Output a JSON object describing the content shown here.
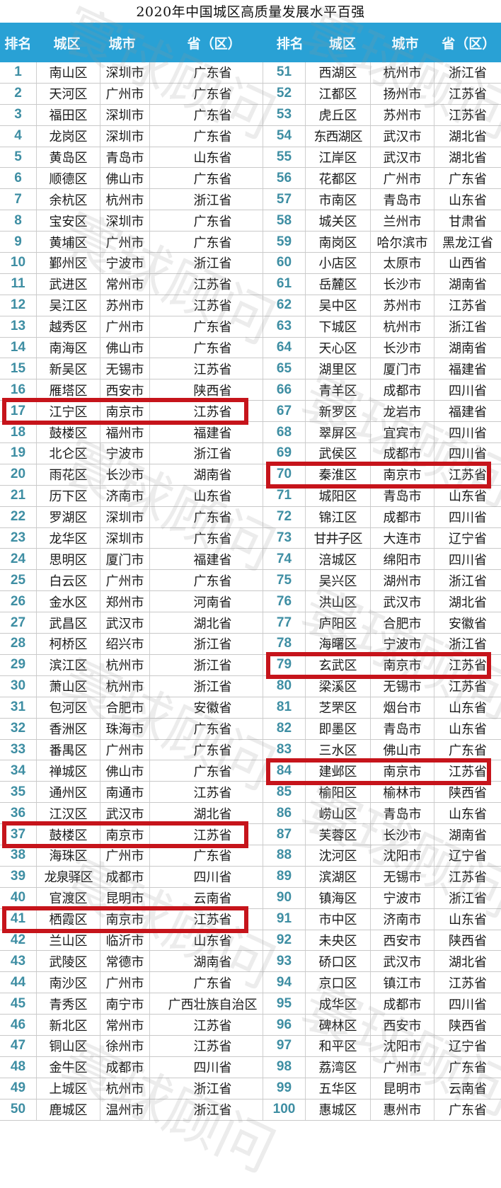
{
  "title": "2020年中国城区高质量发展水平百强",
  "headers": [
    "排名",
    "城区",
    "城市",
    "省（区）",
    "排名",
    "城区",
    "城市",
    "省（区）"
  ],
  "watermark": "寰球顾问",
  "highlight_color": "#c6141b",
  "header_color": "#29a1d5",
  "highlighted_ranks": [
    17,
    37,
    41,
    70,
    79,
    84
  ],
  "rows": [
    {
      "rank": "1",
      "district": "南山区",
      "city": "深圳市",
      "province": "广东省"
    },
    {
      "rank": "2",
      "district": "天河区",
      "city": "广州市",
      "province": "广东省"
    },
    {
      "rank": "3",
      "district": "福田区",
      "city": "深圳市",
      "province": "广东省"
    },
    {
      "rank": "4",
      "district": "龙岗区",
      "city": "深圳市",
      "province": "广东省"
    },
    {
      "rank": "5",
      "district": "黄岛区",
      "city": "青岛市",
      "province": "山东省"
    },
    {
      "rank": "6",
      "district": "顺德区",
      "city": "佛山市",
      "province": "广东省"
    },
    {
      "rank": "7",
      "district": "余杭区",
      "city": "杭州市",
      "province": "浙江省"
    },
    {
      "rank": "8",
      "district": "宝安区",
      "city": "深圳市",
      "province": "广东省"
    },
    {
      "rank": "9",
      "district": "黄埔区",
      "city": "广州市",
      "province": "广东省"
    },
    {
      "rank": "10",
      "district": "鄞州区",
      "city": "宁波市",
      "province": "浙江省"
    },
    {
      "rank": "11",
      "district": "武进区",
      "city": "常州市",
      "province": "江苏省"
    },
    {
      "rank": "12",
      "district": "吴江区",
      "city": "苏州市",
      "province": "江苏省"
    },
    {
      "rank": "13",
      "district": "越秀区",
      "city": "广州市",
      "province": "广东省"
    },
    {
      "rank": "14",
      "district": "南海区",
      "city": "佛山市",
      "province": "广东省"
    },
    {
      "rank": "15",
      "district": "新吴区",
      "city": "无锡市",
      "province": "江苏省"
    },
    {
      "rank": "16",
      "district": "雁塔区",
      "city": "西安市",
      "province": "陕西省"
    },
    {
      "rank": "17",
      "district": "江宁区",
      "city": "南京市",
      "province": "江苏省"
    },
    {
      "rank": "18",
      "district": "鼓楼区",
      "city": "福州市",
      "province": "福建省"
    },
    {
      "rank": "19",
      "district": "北仑区",
      "city": "宁波市",
      "province": "浙江省"
    },
    {
      "rank": "20",
      "district": "雨花区",
      "city": "长沙市",
      "province": "湖南省"
    },
    {
      "rank": "21",
      "district": "历下区",
      "city": "济南市",
      "province": "山东省"
    },
    {
      "rank": "22",
      "district": "罗湖区",
      "city": "深圳市",
      "province": "广东省"
    },
    {
      "rank": "23",
      "district": "龙华区",
      "city": "深圳市",
      "province": "广东省"
    },
    {
      "rank": "24",
      "district": "思明区",
      "city": "厦门市",
      "province": "福建省"
    },
    {
      "rank": "25",
      "district": "白云区",
      "city": "广州市",
      "province": "广东省"
    },
    {
      "rank": "26",
      "district": "金水区",
      "city": "郑州市",
      "province": "河南省"
    },
    {
      "rank": "27",
      "district": "武昌区",
      "city": "武汉市",
      "province": "湖北省"
    },
    {
      "rank": "28",
      "district": "柯桥区",
      "city": "绍兴市",
      "province": "浙江省"
    },
    {
      "rank": "29",
      "district": "滨江区",
      "city": "杭州市",
      "province": "浙江省"
    },
    {
      "rank": "30",
      "district": "萧山区",
      "city": "杭州市",
      "province": "浙江省"
    },
    {
      "rank": "31",
      "district": "包河区",
      "city": "合肥市",
      "province": "安徽省"
    },
    {
      "rank": "32",
      "district": "香洲区",
      "city": "珠海市",
      "province": "广东省"
    },
    {
      "rank": "33",
      "district": "番禺区",
      "city": "广州市",
      "province": "广东省"
    },
    {
      "rank": "34",
      "district": "禅城区",
      "city": "佛山市",
      "province": "广东省"
    },
    {
      "rank": "35",
      "district": "通州区",
      "city": "南通市",
      "province": "江苏省"
    },
    {
      "rank": "36",
      "district": "江汉区",
      "city": "武汉市",
      "province": "湖北省"
    },
    {
      "rank": "37",
      "district": "鼓楼区",
      "city": "南京市",
      "province": "江苏省"
    },
    {
      "rank": "38",
      "district": "海珠区",
      "city": "广州市",
      "province": "广东省"
    },
    {
      "rank": "39",
      "district": "龙泉驿区",
      "city": "成都市",
      "province": "四川省"
    },
    {
      "rank": "40",
      "district": "官渡区",
      "city": "昆明市",
      "province": "云南省"
    },
    {
      "rank": "41",
      "district": "栖霞区",
      "city": "南京市",
      "province": "江苏省"
    },
    {
      "rank": "42",
      "district": "兰山区",
      "city": "临沂市",
      "province": "山东省"
    },
    {
      "rank": "43",
      "district": "武陵区",
      "city": "常德市",
      "province": "湖南省"
    },
    {
      "rank": "44",
      "district": "南沙区",
      "city": "广州市",
      "province": "广东省"
    },
    {
      "rank": "45",
      "district": "青秀区",
      "city": "南宁市",
      "province": "广西壮族自治区"
    },
    {
      "rank": "46",
      "district": "新北区",
      "city": "常州市",
      "province": "江苏省"
    },
    {
      "rank": "47",
      "district": "铜山区",
      "city": "徐州市",
      "province": "江苏省"
    },
    {
      "rank": "48",
      "district": "金牛区",
      "city": "成都市",
      "province": "四川省"
    },
    {
      "rank": "49",
      "district": "上城区",
      "city": "杭州市",
      "province": "浙江省"
    },
    {
      "rank": "50",
      "district": "鹿城区",
      "city": "温州市",
      "province": "浙江省"
    },
    {
      "rank": "51",
      "district": "西湖区",
      "city": "杭州市",
      "province": "浙江省"
    },
    {
      "rank": "52",
      "district": "江都区",
      "city": "扬州市",
      "province": "江苏省"
    },
    {
      "rank": "53",
      "district": "虎丘区",
      "city": "苏州市",
      "province": "江苏省"
    },
    {
      "rank": "54",
      "district": "东西湖区",
      "city": "武汉市",
      "province": "湖北省"
    },
    {
      "rank": "55",
      "district": "江岸区",
      "city": "武汉市",
      "province": "湖北省"
    },
    {
      "rank": "56",
      "district": "花都区",
      "city": "广州市",
      "province": "广东省"
    },
    {
      "rank": "57",
      "district": "市南区",
      "city": "青岛市",
      "province": "山东省"
    },
    {
      "rank": "58",
      "district": "城关区",
      "city": "兰州市",
      "province": "甘肃省"
    },
    {
      "rank": "59",
      "district": "南岗区",
      "city": "哈尔滨市",
      "province": "黑龙江省"
    },
    {
      "rank": "60",
      "district": "小店区",
      "city": "太原市",
      "province": "山西省"
    },
    {
      "rank": "61",
      "district": "岳麓区",
      "city": "长沙市",
      "province": "湖南省"
    },
    {
      "rank": "62",
      "district": "吴中区",
      "city": "苏州市",
      "province": "江苏省"
    },
    {
      "rank": "63",
      "district": "下城区",
      "city": "杭州市",
      "province": "浙江省"
    },
    {
      "rank": "64",
      "district": "天心区",
      "city": "长沙市",
      "province": "湖南省"
    },
    {
      "rank": "65",
      "district": "湖里区",
      "city": "厦门市",
      "province": "福建省"
    },
    {
      "rank": "66",
      "district": "青羊区",
      "city": "成都市",
      "province": "四川省"
    },
    {
      "rank": "67",
      "district": "新罗区",
      "city": "龙岩市",
      "province": "福建省"
    },
    {
      "rank": "68",
      "district": "翠屏区",
      "city": "宜宾市",
      "province": "四川省"
    },
    {
      "rank": "69",
      "district": "武侯区",
      "city": "成都市",
      "province": "四川省"
    },
    {
      "rank": "70",
      "district": "秦淮区",
      "city": "南京市",
      "province": "江苏省"
    },
    {
      "rank": "71",
      "district": "城阳区",
      "city": "青岛市",
      "province": "山东省"
    },
    {
      "rank": "72",
      "district": "锦江区",
      "city": "成都市",
      "province": "四川省"
    },
    {
      "rank": "73",
      "district": "甘井子区",
      "city": "大连市",
      "province": "辽宁省"
    },
    {
      "rank": "74",
      "district": "涪城区",
      "city": "绵阳市",
      "province": "四川省"
    },
    {
      "rank": "75",
      "district": "吴兴区",
      "city": "湖州市",
      "province": "浙江省"
    },
    {
      "rank": "76",
      "district": "洪山区",
      "city": "武汉市",
      "province": "湖北省"
    },
    {
      "rank": "77",
      "district": "庐阳区",
      "city": "合肥市",
      "province": "安徽省"
    },
    {
      "rank": "78",
      "district": "海曙区",
      "city": "宁波市",
      "province": "浙江省"
    },
    {
      "rank": "79",
      "district": "玄武区",
      "city": "南京市",
      "province": "江苏省"
    },
    {
      "rank": "80",
      "district": "梁溪区",
      "city": "无锡市",
      "province": "江苏省"
    },
    {
      "rank": "81",
      "district": "芝罘区",
      "city": "烟台市",
      "province": "山东省"
    },
    {
      "rank": "82",
      "district": "即墨区",
      "city": "青岛市",
      "province": "山东省"
    },
    {
      "rank": "83",
      "district": "三水区",
      "city": "佛山市",
      "province": "广东省"
    },
    {
      "rank": "84",
      "district": "建邺区",
      "city": "南京市",
      "province": "江苏省"
    },
    {
      "rank": "85",
      "district": "榆阳区",
      "city": "榆林市",
      "province": "陕西省"
    },
    {
      "rank": "86",
      "district": "崂山区",
      "city": "青岛市",
      "province": "山东省"
    },
    {
      "rank": "87",
      "district": "芙蓉区",
      "city": "长沙市",
      "province": "湖南省"
    },
    {
      "rank": "88",
      "district": "沈河区",
      "city": "沈阳市",
      "province": "辽宁省"
    },
    {
      "rank": "89",
      "district": "滨湖区",
      "city": "无锡市",
      "province": "江苏省"
    },
    {
      "rank": "90",
      "district": "镇海区",
      "city": "宁波市",
      "province": "浙江省"
    },
    {
      "rank": "91",
      "district": "市中区",
      "city": "济南市",
      "province": "山东省"
    },
    {
      "rank": "92",
      "district": "未央区",
      "city": "西安市",
      "province": "陕西省"
    },
    {
      "rank": "93",
      "district": "硚口区",
      "city": "武汉市",
      "province": "湖北省"
    },
    {
      "rank": "94",
      "district": "京口区",
      "city": "镇江市",
      "province": "江苏省"
    },
    {
      "rank": "95",
      "district": "成华区",
      "city": "成都市",
      "province": "四川省"
    },
    {
      "rank": "96",
      "district": "碑林区",
      "city": "西安市",
      "province": "陕西省"
    },
    {
      "rank": "97",
      "district": "和平区",
      "city": "沈阳市",
      "province": "辽宁省"
    },
    {
      "rank": "98",
      "district": "荔湾区",
      "city": "广州市",
      "province": "广东省"
    },
    {
      "rank": "99",
      "district": "五华区",
      "city": "昆明市",
      "province": "云南省"
    },
    {
      "rank": "100",
      "district": "惠城区",
      "city": "惠州市",
      "province": "广东省"
    }
  ]
}
